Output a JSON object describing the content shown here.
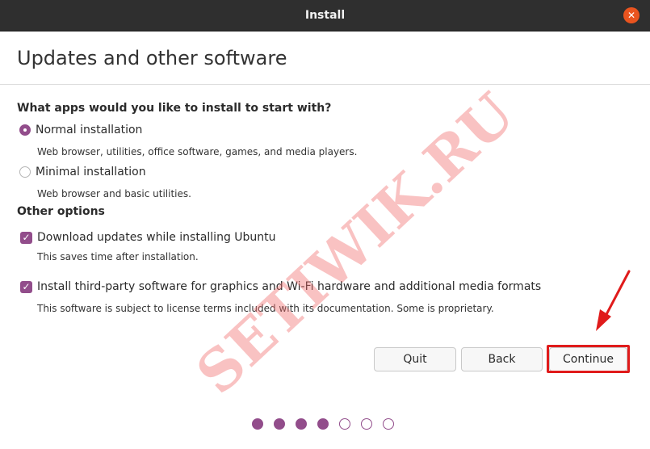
{
  "window": {
    "title": "Install",
    "close_icon": "✕"
  },
  "page": {
    "title": "Updates and other software"
  },
  "apps_section": {
    "heading": "What apps would you like to install to start with?",
    "options": [
      {
        "label": "Normal installation",
        "description": "Web browser, utilities, office software, games, and media players.",
        "selected": true
      },
      {
        "label": "Minimal installation",
        "description": "Web browser and basic utilities.",
        "selected": false
      }
    ]
  },
  "other_options": {
    "heading": "Other options",
    "items": [
      {
        "label": "Download updates while installing Ubuntu",
        "description": "This saves time after installation.",
        "checked": true
      },
      {
        "label": "Install third-party software for graphics and Wi-Fi hardware and additional media formats",
        "description": "This software is subject to license terms included with its documentation. Some is proprietary.",
        "checked": true
      }
    ]
  },
  "buttons": {
    "quit": "Quit",
    "back": "Back",
    "continue": "Continue"
  },
  "progress": {
    "total_steps": 7,
    "completed_steps": 4
  },
  "watermark": "SETIWIK.RU",
  "colors": {
    "accent": "#924d8b",
    "close": "#e9541f",
    "highlight": "#e01b1b",
    "titlebar": "#2f2f2f"
  }
}
